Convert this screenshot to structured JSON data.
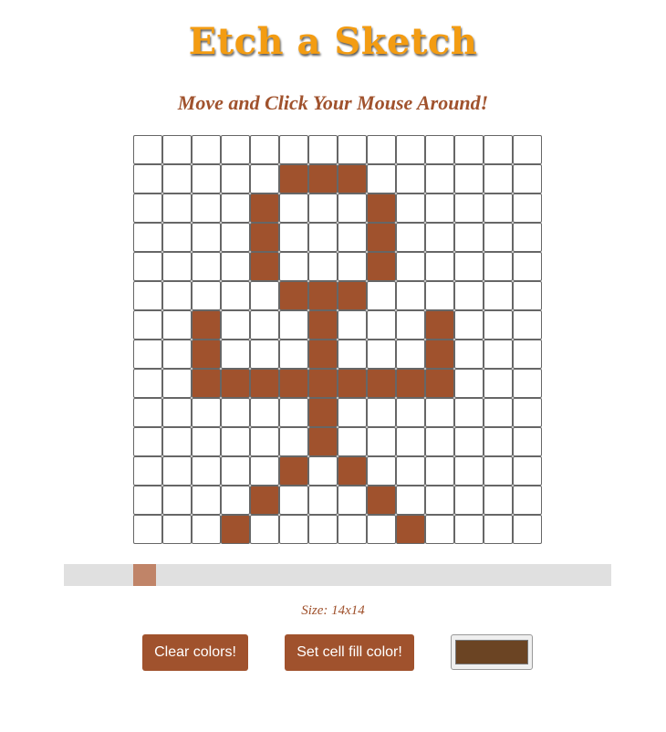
{
  "header": {
    "title": "Etch a Sketch",
    "subtitle": "Move and Click Your Mouse Around!"
  },
  "grid": {
    "rows": 14,
    "cols": 14,
    "fill_color": "#a0522d",
    "empty_color": "#ffffff",
    "filled_cells": [
      [
        1,
        5
      ],
      [
        1,
        6
      ],
      [
        1,
        7
      ],
      [
        2,
        4
      ],
      [
        2,
        8
      ],
      [
        3,
        4
      ],
      [
        3,
        8
      ],
      [
        4,
        4
      ],
      [
        4,
        8
      ],
      [
        5,
        5
      ],
      [
        5,
        6
      ],
      [
        5,
        7
      ],
      [
        6,
        2
      ],
      [
        6,
        6
      ],
      [
        6,
        10
      ],
      [
        7,
        2
      ],
      [
        7,
        6
      ],
      [
        7,
        10
      ],
      [
        8,
        2
      ],
      [
        8,
        3
      ],
      [
        8,
        4
      ],
      [
        8,
        5
      ],
      [
        8,
        6
      ],
      [
        8,
        7
      ],
      [
        8,
        8
      ],
      [
        8,
        9
      ],
      [
        8,
        10
      ],
      [
        9,
        6
      ],
      [
        10,
        6
      ],
      [
        11,
        5
      ],
      [
        11,
        7
      ],
      [
        12,
        4
      ],
      [
        12,
        8
      ],
      [
        13,
        3
      ],
      [
        13,
        9
      ]
    ]
  },
  "slider": {
    "value": 14,
    "min": 1,
    "max": 100,
    "thumb_color": "#c08468",
    "track_color": "#e0e0e0"
  },
  "size_label": "Size: 14x14",
  "controls": {
    "clear_label": "Clear colors!",
    "set_fill_label": "Set cell fill color!",
    "picker_color": "#6b4423"
  }
}
